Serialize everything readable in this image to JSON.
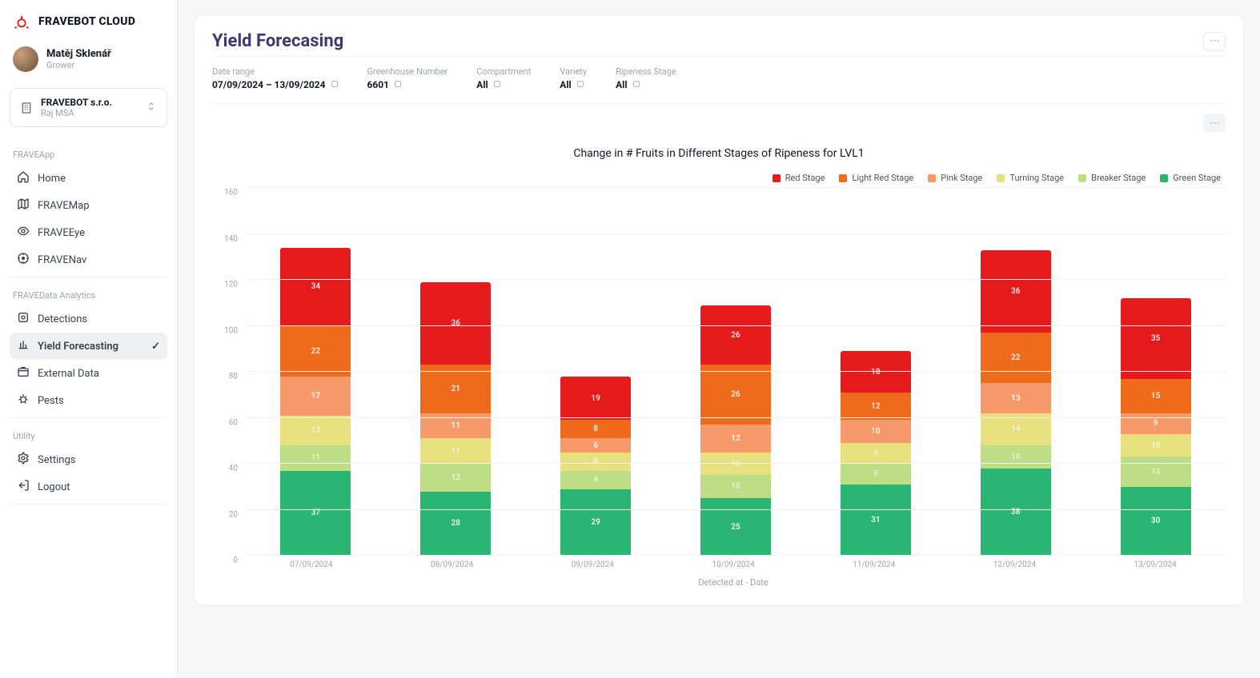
{
  "brand": "FRAVEBOT CLOUD",
  "user": {
    "name": "Matěj Sklenář",
    "role": "Grower"
  },
  "org": {
    "name": "FRAVEBOT s.r.o.",
    "sub": "Raj MSA"
  },
  "sidebar": {
    "sections": [
      {
        "heading": "FRAVEApp",
        "items": [
          {
            "icon": "home",
            "label": "Home"
          },
          {
            "icon": "map",
            "label": "FRAVEMap"
          },
          {
            "icon": "eye",
            "label": "FRAVEEye"
          },
          {
            "icon": "nav",
            "label": "FRAVENav"
          }
        ]
      },
      {
        "heading": "FRAVEData Analytics",
        "items": [
          {
            "icon": "detect",
            "label": "Detections"
          },
          {
            "icon": "forecast",
            "label": "Yield Forecasting",
            "active": true
          },
          {
            "icon": "external",
            "label": "External Data"
          },
          {
            "icon": "pests",
            "label": "Pests"
          }
        ]
      },
      {
        "heading": "Utility",
        "items": [
          {
            "icon": "settings",
            "label": "Settings"
          },
          {
            "icon": "logout",
            "label": "Logout"
          }
        ]
      }
    ]
  },
  "page": {
    "title": "Yield Forecasing"
  },
  "filters": [
    {
      "label": "Date range",
      "value": "07/09/2024 – 13/09/2024",
      "drop": true
    },
    {
      "label": "Greenhouse Number",
      "value": "6601",
      "drop": true
    },
    {
      "label": "Compartment",
      "value": "All",
      "drop": true
    },
    {
      "label": "Variety",
      "value": "All",
      "drop": true
    },
    {
      "label": "Ripeness Stage",
      "value": "All",
      "drop": true
    }
  ],
  "chart_data": {
    "type": "bar",
    "title": "Change in # Fruits in Different Stages of Ripeness for LVL1",
    "xlabel": "Detected at - Date",
    "ylabel": "",
    "ylim": [
      0,
      160
    ],
    "yticks": [
      0,
      20,
      40,
      60,
      80,
      100,
      120,
      140,
      160
    ],
    "categories": [
      "07/09/2024",
      "08/09/2024",
      "09/09/2024",
      "10/09/2024",
      "11/09/2024",
      "12/09/2024",
      "13/09/2024"
    ],
    "series": [
      {
        "name": "Red Stage",
        "color": "#e6191d",
        "values": [
          34,
          36,
          19,
          26,
          18,
          36,
          35
        ]
      },
      {
        "name": "Light Red Stage",
        "color": "#f06a1b",
        "values": [
          22,
          21,
          8,
          26,
          12,
          22,
          15
        ]
      },
      {
        "name": "Pink Stage",
        "color": "#f79a6a",
        "values": [
          17,
          11,
          6,
          12,
          10,
          13,
          9
        ]
      },
      {
        "name": "Turning Stage",
        "color": "#e8df7e",
        "values": [
          13,
          11,
          8,
          10,
          9,
          14,
          10
        ]
      },
      {
        "name": "Breaker Stage",
        "color": "#bdde84",
        "values": [
          11,
          12,
          8,
          10,
          9,
          10,
          13
        ]
      },
      {
        "name": "Green Stage",
        "color": "#2bb572",
        "values": [
          37,
          28,
          29,
          25,
          31,
          38,
          30
        ]
      }
    ]
  },
  "icons": {
    "ellipsis": "⋯",
    "chevupdown": "⇅",
    "dropdown": "▾",
    "check": "✓"
  }
}
